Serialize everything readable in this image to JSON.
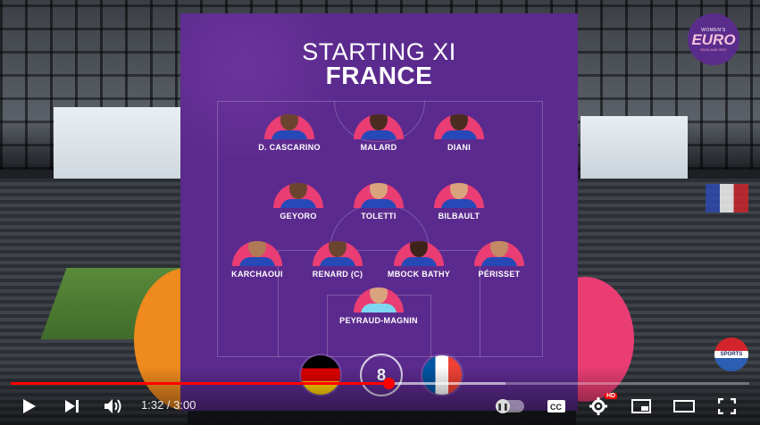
{
  "card": {
    "title_line1": "STARTING XI",
    "title_line2": "FRANCE"
  },
  "players": [
    {
      "name": "D. CASCARINO",
      "role": "forward"
    },
    {
      "name": "MALARD",
      "role": "forward"
    },
    {
      "name": "DIANI",
      "role": "forward"
    },
    {
      "name": "GEYORO",
      "role": "midfielder"
    },
    {
      "name": "TOLETTI",
      "role": "midfielder"
    },
    {
      "name": "BILBAULT",
      "role": "midfielder"
    },
    {
      "name": "KARCHAOUI",
      "role": "defender"
    },
    {
      "name": "RENARD (C)",
      "role": "defender"
    },
    {
      "name": "MBOCK BATHY",
      "role": "defender"
    },
    {
      "name": "PÉRISSET",
      "role": "defender"
    },
    {
      "name": "PEYRAUD-MAGNIN",
      "role": "goalkeeper"
    }
  ],
  "matchup": {
    "home_flag": "germany-flag-icon",
    "center_logo": "womens-euro-logo-icon",
    "away_flag": "france-flag-icon",
    "center_mark": "8"
  },
  "branding": {
    "logo_line1": "WOMEN'S",
    "logo_line2": "EURO",
    "logo_line3": "ENGLAND 2022",
    "sports_badge": "SPORTS"
  },
  "player_bar": {
    "current_time": "1:32",
    "duration": "3:00",
    "time_display": "1:32 / 3:00",
    "progress_fraction": 0.511,
    "buffered_fraction": 0.67,
    "hd_badge": "HD",
    "accent_color": "#ff0000"
  },
  "colors": {
    "card_bg": "#5b2a8e",
    "avatar_arc": "#e93d74",
    "shirt": "#2749b8"
  }
}
